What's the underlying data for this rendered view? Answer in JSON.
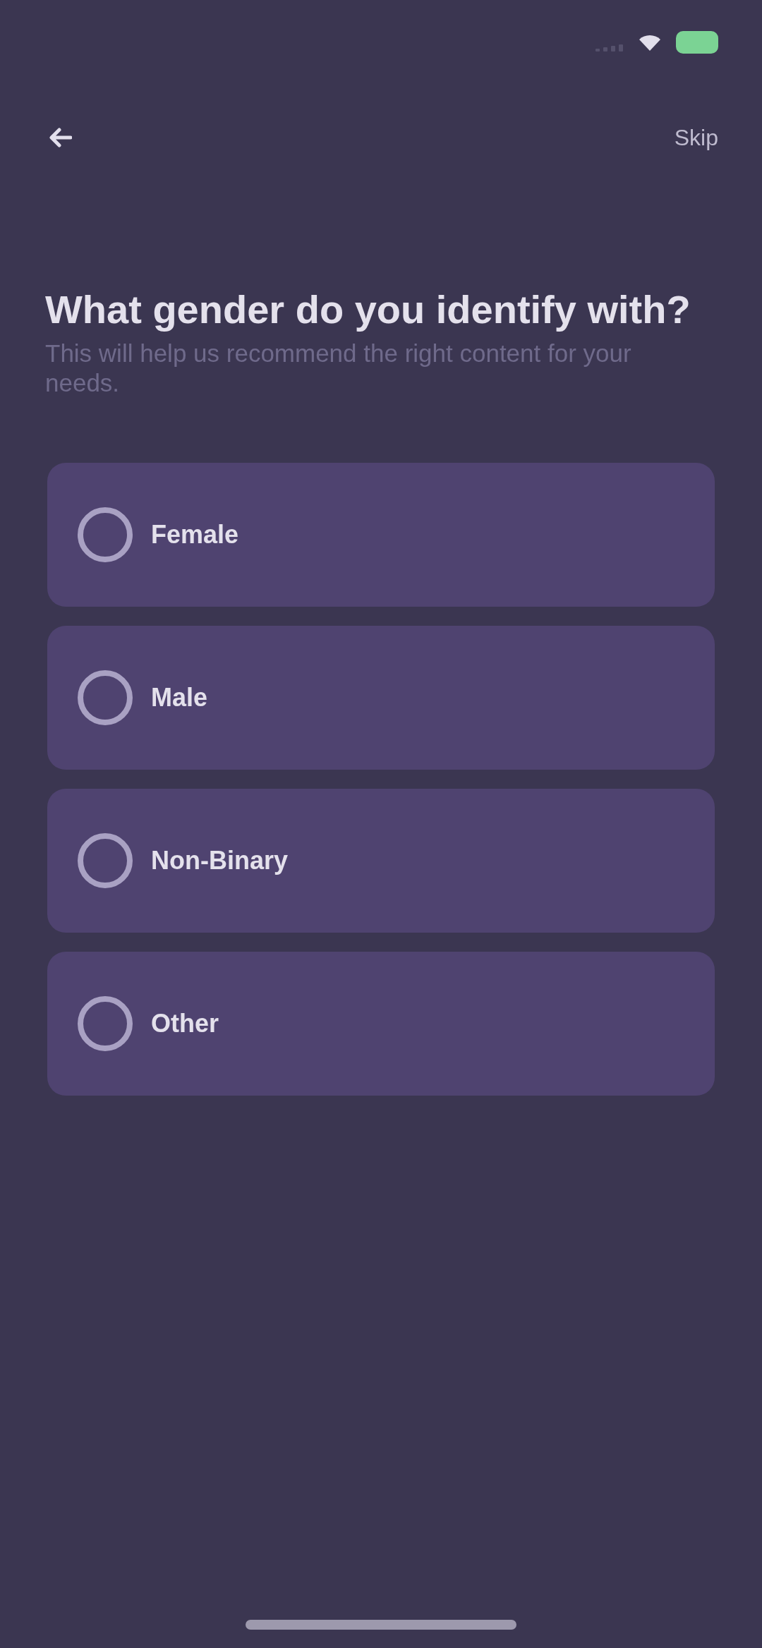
{
  "nav": {
    "skip": "Skip"
  },
  "question": {
    "title": "What gender do you identify with?",
    "subtitle": "This will help us recommend the right content for your needs."
  },
  "options": [
    {
      "label": "Female",
      "selected": false
    },
    {
      "label": "Male",
      "selected": false
    },
    {
      "label": "Non-Binary",
      "selected": false
    },
    {
      "label": "Other",
      "selected": false
    }
  ]
}
